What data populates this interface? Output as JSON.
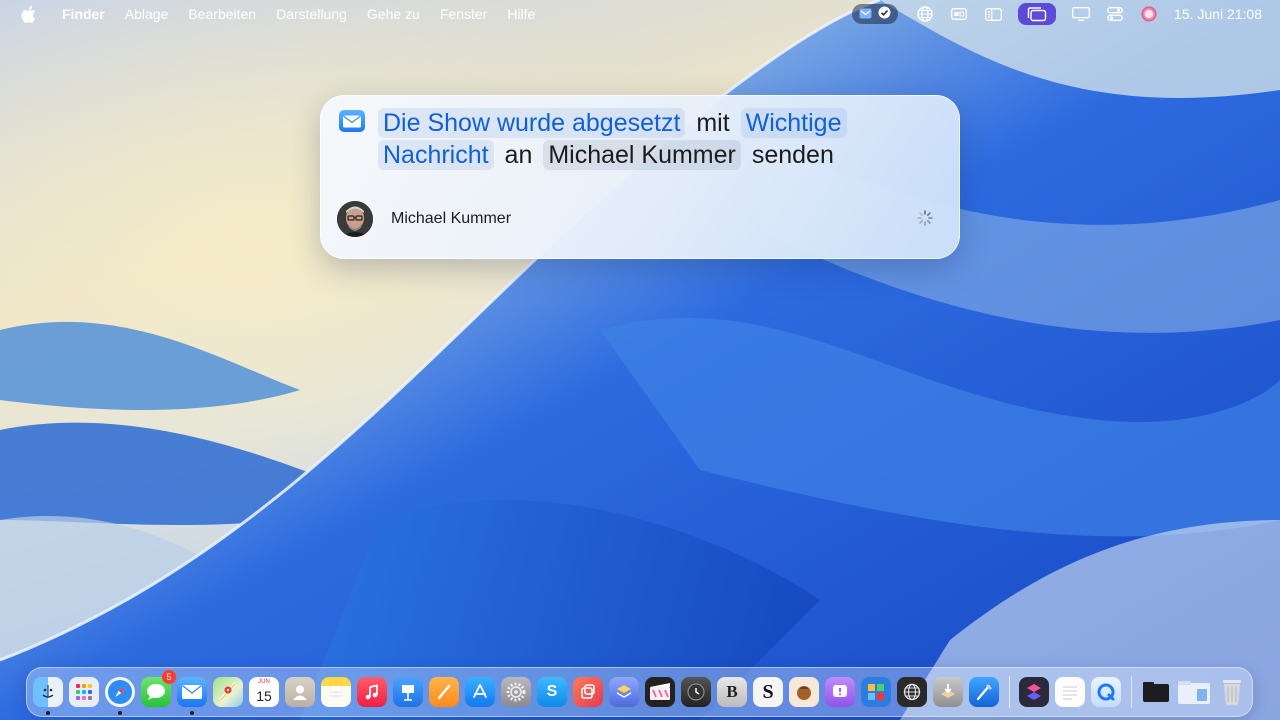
{
  "menubar": {
    "app_name": "Finder",
    "menus": [
      "Ablage",
      "Bearbeiten",
      "Darstellung",
      "Gehe zu",
      "Fenster",
      "Hilfe"
    ],
    "status_icons": [
      "shortcuts-status-icon",
      "checkmark-status-icon",
      "globe-icon",
      "display-icon",
      "sidebar-icon",
      "stage-manager-icon",
      "screen-mirroring-icon",
      "control-center-icon",
      "siri-icon"
    ],
    "clock": "15. Juni 21:08"
  },
  "card": {
    "sentence": {
      "message": "Die Show wurde abgesetzt",
      "with": "mit",
      "subject": "Wichtige Nachricht",
      "to": "an",
      "recipient": "Michael Kummer",
      "send": "senden"
    },
    "recipient_name": "Michael Kummer",
    "accent_color": "#1060d8"
  },
  "dock": {
    "apps": [
      {
        "name": "finder-icon",
        "running": true
      },
      {
        "name": "launchpad-icon",
        "running": false
      },
      {
        "name": "safari-icon",
        "running": true
      },
      {
        "name": "messages-icon",
        "running": false,
        "badge": "5"
      },
      {
        "name": "mail-icon",
        "running": true
      },
      {
        "name": "maps-icon",
        "running": false
      },
      {
        "name": "calendar-icon",
        "running": false,
        "day": "15",
        "month": "JUN"
      },
      {
        "name": "contacts-icon",
        "running": false
      },
      {
        "name": "notes-icon",
        "running": false
      },
      {
        "name": "music-icon",
        "running": false
      },
      {
        "name": "keynote-icon",
        "running": false
      },
      {
        "name": "pages-icon",
        "running": false
      },
      {
        "name": "app-store-icon",
        "running": false
      },
      {
        "name": "system-settings-icon",
        "running": false
      },
      {
        "name": "skype-icon",
        "running": false
      },
      {
        "name": "affinity-icon",
        "running": false
      },
      {
        "name": "stack-icon",
        "running": false
      },
      {
        "name": "final-cut-icon",
        "running": false
      },
      {
        "name": "tv-icon",
        "running": false
      },
      {
        "name": "bbedit-icon",
        "running": false
      },
      {
        "name": "scrivener-icon",
        "running": false
      },
      {
        "name": "squirrel-icon",
        "running": false
      },
      {
        "name": "notification-icon",
        "running": false
      },
      {
        "name": "collage-icon",
        "running": false
      },
      {
        "name": "network-globe-icon",
        "running": false
      },
      {
        "name": "installer-icon",
        "running": false
      },
      {
        "name": "xcode-icon",
        "running": false
      },
      {
        "name": "shortcuts-app-icon",
        "running": false
      },
      {
        "name": "textedit-icon",
        "running": false
      },
      {
        "name": "quicktime-icon",
        "running": false
      },
      {
        "name": "terminal-folder-icon",
        "running": false
      },
      {
        "name": "downloads-folder-icon",
        "running": false
      },
      {
        "name": "trash-icon",
        "running": false
      }
    ]
  }
}
